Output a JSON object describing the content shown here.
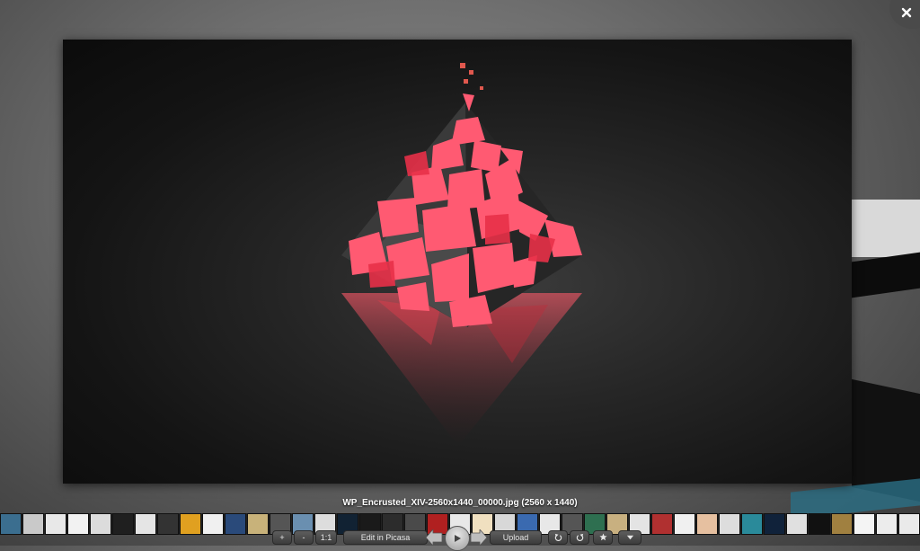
{
  "viewer": {
    "caption": "WP_Encrusted_XIV-2560x1440_00000.jpg (2560 x 1440)"
  },
  "toolbar": {
    "zoom_in_label": "+",
    "zoom_out_label": "-",
    "actual_size_label": "1:1",
    "edit_label": "Edit in Picasa",
    "upload_label": "Upload"
  },
  "icons": {
    "close": "close-icon",
    "prev": "arrow-left-icon",
    "play": "play-icon",
    "next": "arrow-right-icon",
    "rotate_left": "rotate-left-icon",
    "rotate_right": "rotate-right-icon",
    "star": "star-icon",
    "more": "chevron-down-icon"
  },
  "filmstrip": {
    "thumb_colors": [
      "#3b6e8f",
      "#c9c9c9",
      "#e8e8e8",
      "#f2f2f2",
      "#dcdcdc",
      "#1f1f1f",
      "#e5e5e5",
      "#333",
      "#e0a020",
      "#f0f0f0",
      "#2a4a7a",
      "#c8b27a",
      "#555",
      "#6a8fb0",
      "#ddd",
      "#123",
      "#1a1a1a",
      "#2c2c2c",
      "#4a4a4a",
      "#b02020",
      "#e8e8e8",
      "#f0e0c0",
      "#d8d8d8",
      "#3a6ab0",
      "#e8e8e8",
      "#555",
      "#2e6f50",
      "#c8b080",
      "#e4e4e4",
      "#b03030",
      "#f0f0f0",
      "#e6c0a0",
      "#ddd",
      "#2a8a9a",
      "#10223a",
      "#e0e0e0",
      "#111",
      "#a08040",
      "#f4f4f4",
      "#ececec",
      "#eaeaea"
    ]
  }
}
